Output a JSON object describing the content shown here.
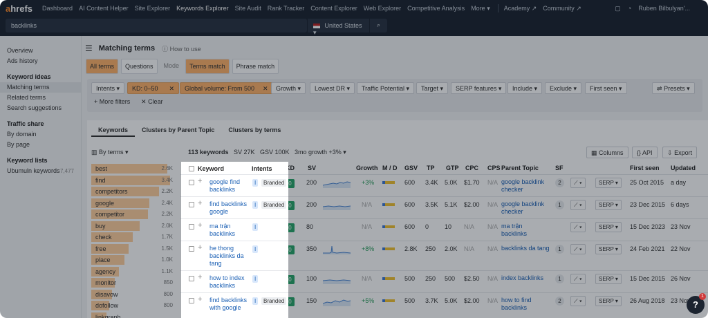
{
  "app": {
    "logo": "ahrefs",
    "nav": [
      "Dashboard",
      "AI Content Helper",
      "Site Explorer",
      "Keywords Explorer",
      "Site Audit",
      "Rank Tracker",
      "Content Explorer",
      "Web Explorer",
      "Competitive Analysis",
      "More ▾"
    ],
    "nav_active_index": 3,
    "nav2": [
      "Academy ↗",
      "Community ↗"
    ],
    "user": "Ruben Bilbulyan'..."
  },
  "search": {
    "value": "backlinks",
    "country": "United States ▾"
  },
  "sidebar": {
    "items_top": [
      "Overview",
      "Ads history"
    ],
    "ideas_head": "Keyword ideas",
    "ideas": [
      "Matching terms",
      "Related terms",
      "Search suggestions"
    ],
    "traffic_head": "Traffic share",
    "traffic": [
      "By domain",
      "By page"
    ],
    "lists_head": "Keyword lists",
    "list_item": "Ubumuln keywords",
    "list_count": "7,477"
  },
  "header": {
    "title": "Matching terms",
    "help": "How to use"
  },
  "match_tabs": [
    "All terms",
    "Questions",
    "Mode",
    "Terms match",
    "Phrase match"
  ],
  "filters": {
    "intents": "Intents ▾",
    "kd": "KD: 0–50",
    "gv": "Global volume: From 500",
    "growth": "Growth ▾",
    "lowest_dr": "Lowest DR ▾",
    "traffic": "Traffic Potential ▾",
    "target": "Target ▾",
    "serp": "SERP features ▾",
    "include": "Include ▾",
    "exclude": "Exclude ▾",
    "first_seen": "First seen ▾",
    "presets": "Presets ▾",
    "more": "More filters",
    "clear": "Clear"
  },
  "panel_tabs": [
    "Keywords",
    "Clusters by Parent Topic",
    "Clusters by terms"
  ],
  "toolbar": {
    "by_terms": "By terms ▾",
    "count": "113 keywords",
    "sv": "SV 27K",
    "gsv": "GSV 100K",
    "growth": "3mo growth +3% ▾",
    "columns": "Columns",
    "api": "API",
    "export": "Export"
  },
  "terms": [
    {
      "t": "best",
      "v": "2.6K",
      "r": 0.92
    },
    {
      "t": "find",
      "v": "3.4K",
      "r": 0.95
    },
    {
      "t": "competitors",
      "v": "2.2K",
      "r": 0.82
    },
    {
      "t": "google",
      "v": "2.4K",
      "r": 0.7
    },
    {
      "t": "competitor",
      "v": "2.2K",
      "r": 0.68
    },
    {
      "t": "buy",
      "v": "2.0K",
      "r": 0.58
    },
    {
      "t": "check",
      "v": "1.7K",
      "r": 0.5
    },
    {
      "t": "free",
      "v": "1.5K",
      "r": 0.45
    },
    {
      "t": "place",
      "v": "1.0K",
      "r": 0.4
    },
    {
      "t": "agency",
      "v": "1.1K",
      "r": 0.33
    },
    {
      "t": "monitor",
      "v": "850",
      "r": 0.28
    },
    {
      "t": "disavow",
      "v": "800",
      "r": 0.25
    },
    {
      "t": "dofollow",
      "v": "800",
      "r": 0.22
    },
    {
      "t": "linkgraph",
      "v": "",
      "r": 0.18
    }
  ],
  "columns": [
    "Keyword",
    "Intents",
    "KD",
    "SV",
    "Growth",
    "M / D",
    "GSV",
    "TP",
    "GTP",
    "CPC",
    "CPS",
    "Parent Topic",
    "SF",
    "",
    "",
    "First seen",
    "Updated"
  ],
  "rows": [
    {
      "kw": "google find backlinks",
      "intent": "I",
      "branded": "Branded",
      "kd": "0",
      "sv": "200",
      "growth": "+3%",
      "gsv": "600",
      "tp": "3.4K",
      "gtp": "5.0K",
      "cpc": "$1.70",
      "cps": "N/A",
      "pt": "google backlink checker",
      "sf": "2",
      "serp": "SERP ▾",
      "fs": "25 Oct 2015",
      "upd": "a day"
    },
    {
      "kw": "find backlinks google",
      "intent": "I",
      "branded": "Branded",
      "kd": "0",
      "sv": "200",
      "growth": "N/A",
      "gsv": "600",
      "tp": "3.5K",
      "gtp": "5.1K",
      "cpc": "$2.00",
      "cps": "N/A",
      "pt": "google backlink checker",
      "sf": "1",
      "serp": "SERP ▾",
      "fs": "23 Dec 2015",
      "upd": "6 days"
    },
    {
      "kw": "ma trận backlinks",
      "intent": "I",
      "branded": "",
      "kd": "0",
      "sv": "80",
      "growth": "N/A",
      "gsv": "600",
      "tp": "0",
      "gtp": "10",
      "cpc": "N/A",
      "cps": "N/A",
      "pt": "ma trận backlinks",
      "sf": "",
      "serp": "SERP ▾",
      "fs": "15 Dec 2023",
      "upd": "23 Nov"
    },
    {
      "kw": "he thong backlinks da tang",
      "intent": "I",
      "branded": "",
      "kd": "0",
      "sv": "350",
      "growth": "+8%",
      "gsv": "2.8K",
      "tp": "250",
      "gtp": "2.0K",
      "cpc": "N/A",
      "cps": "N/A",
      "pt": "backlinks da tang",
      "sf": "1",
      "serp": "SERP ▾",
      "fs": "24 Feb 2021",
      "upd": "22 Nov"
    },
    {
      "kw": "how to index backlinks",
      "intent": "I",
      "branded": "",
      "kd": "0",
      "sv": "100",
      "growth": "N/A",
      "gsv": "500",
      "tp": "250",
      "gtp": "500",
      "cpc": "$2.50",
      "cps": "N/A",
      "pt": "index backlinks",
      "sf": "1",
      "serp": "SERP ▾",
      "fs": "15 Dec 2015",
      "upd": "26 Nov"
    },
    {
      "kw": "find backlinks with google",
      "intent": "I",
      "branded": "Branded",
      "kd": "0",
      "sv": "150",
      "growth": "+5%",
      "gsv": "500",
      "tp": "3.7K",
      "gtp": "5.0K",
      "cpc": "$2.00",
      "cps": "N/A",
      "pt": "how to find backlinks",
      "sf": "2",
      "serp": "SERP ▾",
      "fs": "26 Aug 2018",
      "upd": "23 Nov"
    }
  ],
  "help_badge": "1",
  "colors": {
    "nav_bg": "#1c2430",
    "accent": "#ffb36b",
    "kd_green": "#29a66b",
    "link": "#1a5fb4"
  }
}
